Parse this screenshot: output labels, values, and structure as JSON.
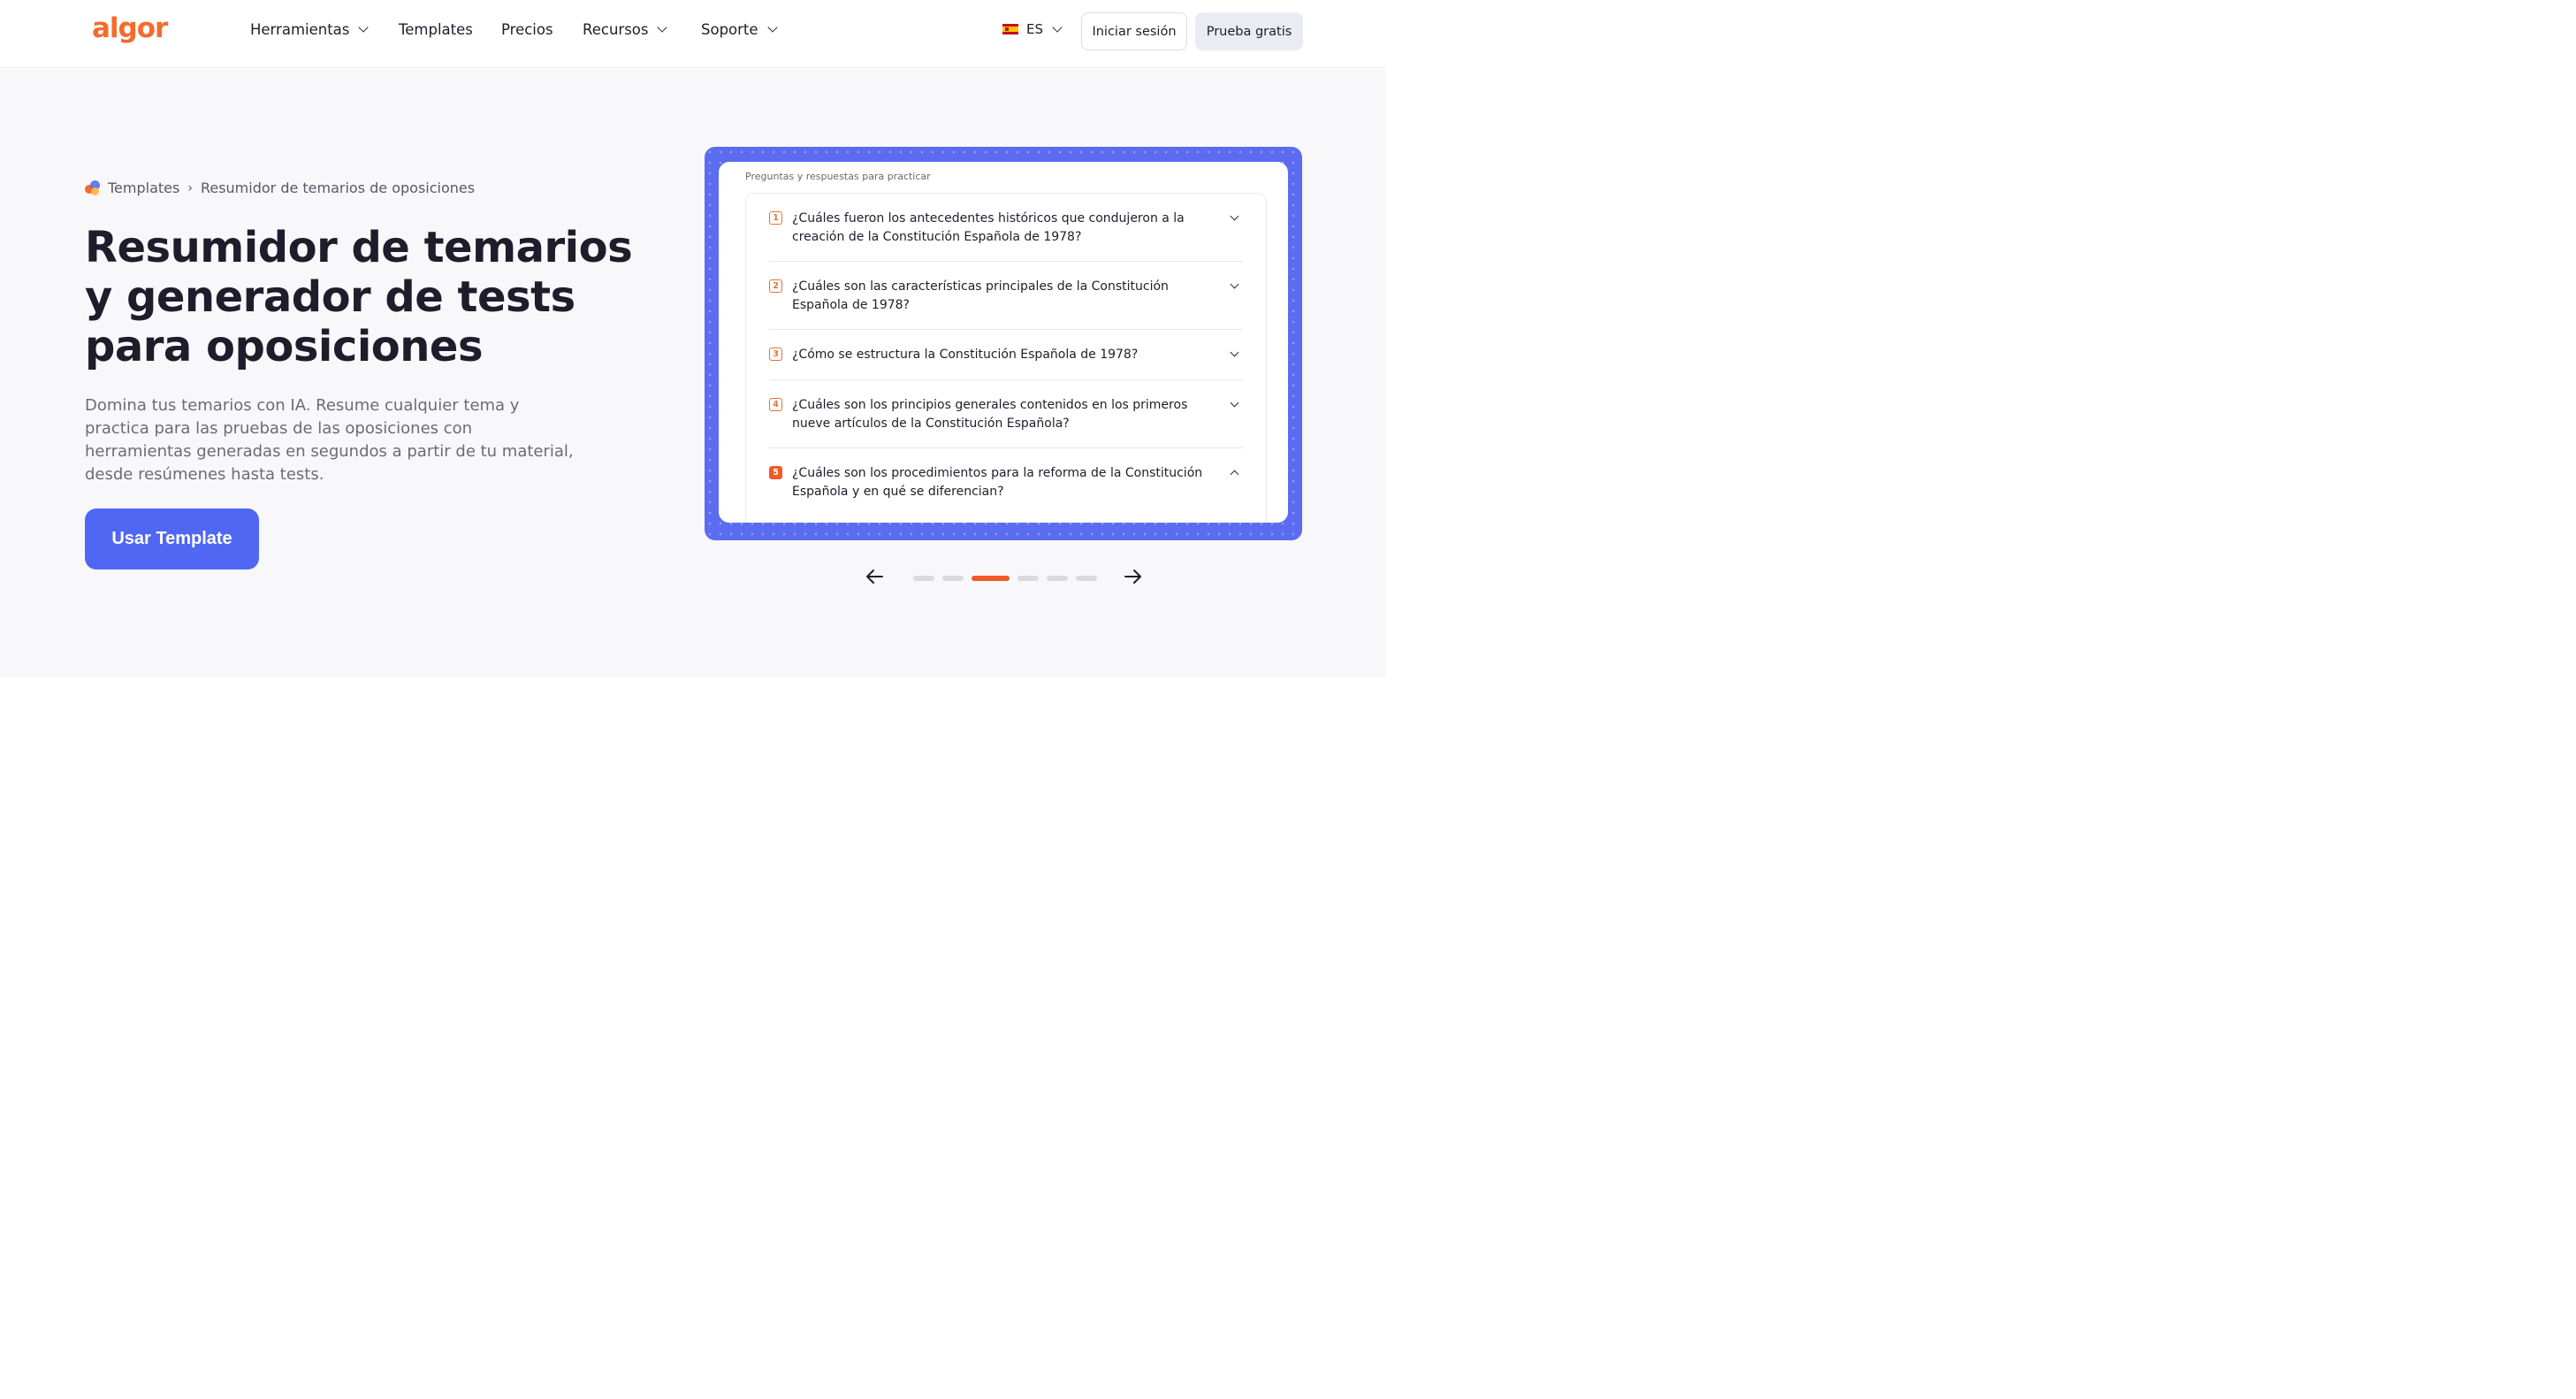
{
  "header": {
    "logo": "algor",
    "nav": [
      {
        "label": "Herramientas",
        "dropdown": true
      },
      {
        "label": "Templates",
        "dropdown": false
      },
      {
        "label": "Precios",
        "dropdown": false
      },
      {
        "label": "Recursos",
        "dropdown": true
      },
      {
        "label": "Soporte",
        "dropdown": true
      }
    ],
    "language": "ES",
    "login_label": "Iniciar sesión",
    "trial_label": "Prueba gratis"
  },
  "hero": {
    "breadcrumb": {
      "parent": "Templates",
      "current": "Resumidor de temarios de oposiciones"
    },
    "title": "Resumidor de temarios y generador de tests para oposiciones",
    "description": "Domina tus temarios con IA. Resume cualquier tema y practica para las pruebas de las oposiciones con herramientas generadas en segundos a partir de tu material, desde resúmenes hasta tests.",
    "cta_label": "Usar Template"
  },
  "preview": {
    "label": "Preguntas y respuestas para practicar",
    "questions": [
      {
        "num": "1",
        "text": "¿Cuáles fueron los antecedentes históricos que condujeron a la creación de la Constitución Española de 1978?",
        "expanded": false
      },
      {
        "num": "2",
        "text": "¿Cuáles son las características principales de la Constitución Española de 1978?",
        "expanded": false
      },
      {
        "num": "3",
        "text": "¿Cómo se estructura la Constitución Española de 1978?",
        "expanded": false
      },
      {
        "num": "4",
        "text": "¿Cuáles son los principios generales contenidos en los primeros nueve artículos de la Constitución Española?",
        "expanded": false
      },
      {
        "num": "5",
        "text": "¿Cuáles son los procedimientos para la reforma de la Constitución Española y en qué se diferencian?",
        "expanded": true
      }
    ]
  },
  "carousel": {
    "total": 6,
    "active": 3
  },
  "colors": {
    "brand_orange": "#f46b2b",
    "accent_blue": "#4f67f2",
    "frame_blue": "#5b6cf0"
  }
}
